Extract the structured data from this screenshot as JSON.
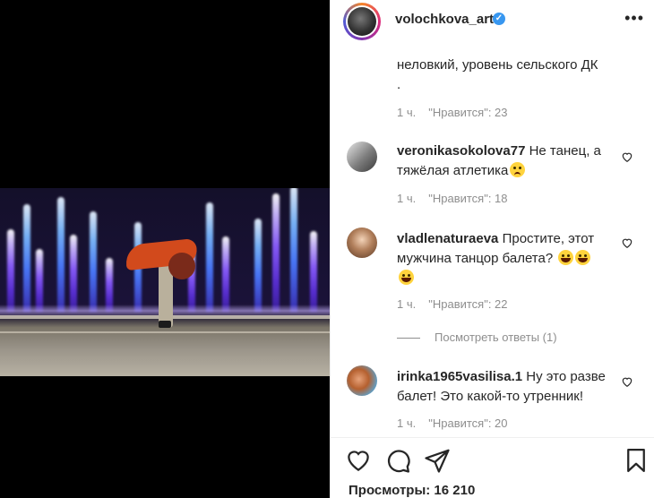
{
  "header": {
    "username": "volochkova_art",
    "verified_icon": "verified-badge-icon",
    "more_icon": "more-dots-icon",
    "more_label": "•••"
  },
  "comments": [
    {
      "continued_text": "неловкий, уровень сельского ДК",
      "continued_tail": ".",
      "time": "1 ч.",
      "likes": "\"Нравится\": 23"
    },
    {
      "username": "veronikasokolova77",
      "text_a": "Не танец, а",
      "text_b": "тяжёлая атлетика",
      "emoji": "sad-face-emoji",
      "time": "1 ч.",
      "likes": "\"Нравится\": 18"
    },
    {
      "username": "vladlenaturaeva",
      "text_a": "Простите, этот",
      "text_b": "мужчина танцор балета?",
      "emoji": "laughing-tears-emoji",
      "time": "1 ч.",
      "likes": "\"Нравится\": 22",
      "view_replies": "Посмотреть ответы (1)"
    },
    {
      "username": "irinka1965vasilisa.1",
      "text_a": "Ну это разве",
      "text_b": "балет! Это какой-то утренник!",
      "time": "1 ч.",
      "likes": "\"Нравится\": 20"
    }
  ],
  "actions": {
    "like_icon": "heart-icon",
    "comment_icon": "comment-icon",
    "share_icon": "paper-plane-icon",
    "save_icon": "bookmark-icon"
  },
  "views": "Просмотры: 16 210",
  "colors": {
    "text": "#262626",
    "muted": "#8e8e8e",
    "verified": "#3897f0",
    "media_bg": "#000000"
  }
}
